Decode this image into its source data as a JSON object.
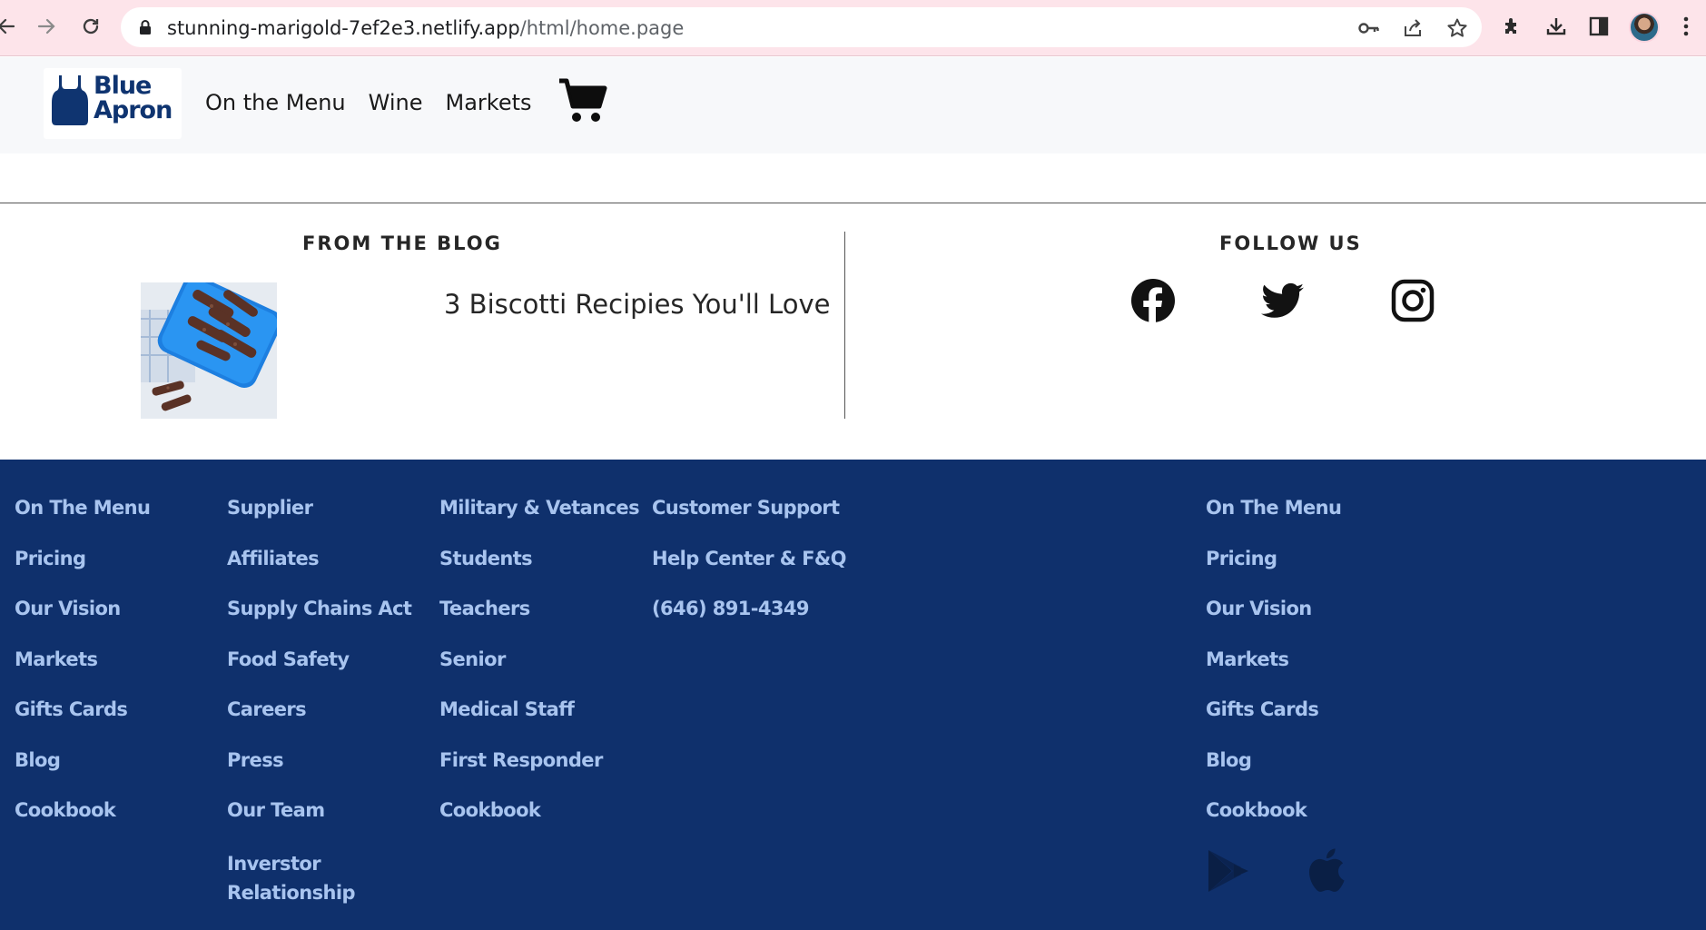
{
  "browser": {
    "url_host": "stunning-marigold-7ef2e3.netlify.app",
    "url_path": "/html/home.page"
  },
  "header": {
    "logo_line1": "Blue",
    "logo_line2": "Apron",
    "nav": [
      "On the Menu",
      "Wine",
      "Markets"
    ]
  },
  "blog": {
    "heading": "FROM THE BLOG",
    "post_title": "3 Biscotti Recipies You'll Love"
  },
  "follow": {
    "heading": "FOLLOW US",
    "icons": [
      "facebook-icon",
      "twitter-icon",
      "instagram-icon"
    ]
  },
  "footer": {
    "col1": [
      "On The Menu",
      "Pricing",
      "Our Vision",
      "Markets",
      "Gifts Cards",
      "Blog",
      "Cookbook"
    ],
    "col2": [
      "Supplier",
      "Affiliates",
      "Supply Chains Act",
      "Food Safety",
      "Careers",
      "Press",
      "Our Team",
      "Inverstor Relationship"
    ],
    "col3": [
      "Military & Vetances",
      "Students",
      "Teachers",
      "Senior",
      "Medical Staff",
      "First Responder",
      "Cookbook"
    ],
    "col4": [
      "Customer Support",
      "Help Center & F&Q",
      "(646) 891-4349"
    ],
    "col5": [
      "On The Menu",
      "Pricing",
      "Our Vision",
      "Markets",
      "Gifts Cards",
      "Blog",
      "Cookbook"
    ],
    "app_icons": [
      "google-play-icon",
      "apple-icon"
    ]
  },
  "colors": {
    "footer_bg": "#0f306c",
    "footer_link": "#a8c4ef",
    "brand": "#0f3470",
    "chrome_bg": "#fde4ea"
  }
}
